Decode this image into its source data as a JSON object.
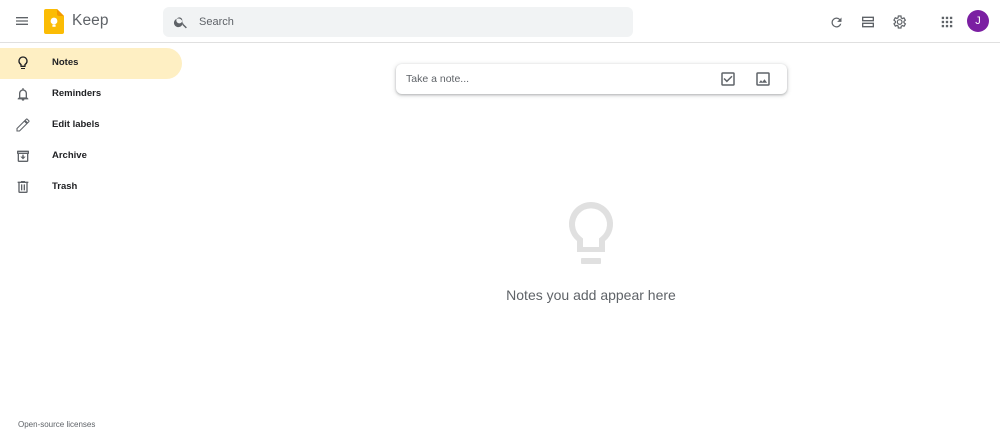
{
  "header": {
    "app_title": "Keep",
    "search_placeholder": "Search",
    "avatar_initial": "J"
  },
  "sidebar": {
    "items": [
      {
        "label": "Notes",
        "icon": "lightbulb-icon",
        "active": true
      },
      {
        "label": "Reminders",
        "icon": "bell-icon",
        "active": false
      },
      {
        "label": "Edit labels",
        "icon": "pencil-icon",
        "active": false
      },
      {
        "label": "Archive",
        "icon": "archive-icon",
        "active": false
      },
      {
        "label": "Trash",
        "icon": "trash-icon",
        "active": false
      }
    ],
    "footer_link": "Open-source licenses"
  },
  "main": {
    "note_placeholder": "Take a note...",
    "empty_state_text": "Notes you add appear here"
  },
  "colors": {
    "active_nav_bg": "#feefc3",
    "logo_yellow": "#fbbc04",
    "avatar_bg": "#7b1fa2",
    "search_bg": "#f1f3f4"
  }
}
